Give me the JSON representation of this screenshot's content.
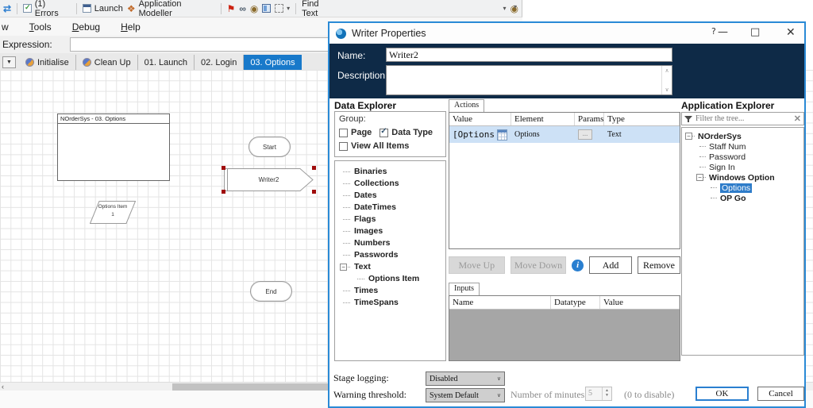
{
  "toolbar": {
    "errors_label": "(1) Errors",
    "launch_label": "Launch",
    "app_modeller_label": "Application Modeller",
    "find_text_label": "Find Text"
  },
  "menubar": {
    "items": [
      "w",
      "Tools",
      "Debug",
      "Help"
    ]
  },
  "expression": {
    "label": "Expression:",
    "value": ""
  },
  "tabs": {
    "initialise": "Initialise",
    "cleanup": "Clean Up",
    "launch": "01. Launch",
    "login": "02. Login",
    "options": "03. Options"
  },
  "diagram": {
    "page_box_title": "NOrderSys - 03. Options",
    "start_label": "Start",
    "writer_label": "Writer2",
    "data_item_label": "Options Item",
    "data_item_value": "1",
    "end_label": "End"
  },
  "dialog": {
    "title": "Writer Properties",
    "window_buttons": {
      "help": "?",
      "minimize": "—",
      "maximize": "□",
      "close": "✕"
    },
    "name_label": "Name:",
    "name_value": "Writer2",
    "description_label": "Description:",
    "description_value": "",
    "data_explorer": {
      "heading": "Data Explorer",
      "group_label": "Group:",
      "checkboxes": [
        {
          "label": "Page",
          "checked": false
        },
        {
          "label": "Data Type",
          "checked": true
        },
        {
          "label": "View All Items",
          "checked": false
        }
      ],
      "tree": [
        "Binaries",
        "Collections",
        "Dates",
        "DateTimes",
        "Flags",
        "Images",
        "Numbers",
        "Passwords",
        "Text",
        "Options Item",
        "Times",
        "TimeSpans"
      ]
    },
    "actions": {
      "tab_label": "Actions",
      "columns": [
        "Value",
        "Element",
        "Params",
        "Type"
      ],
      "row": {
        "value": "[Options",
        "element": "Options",
        "params": "...",
        "type": "Text"
      },
      "move_up": "Move Up",
      "move_down": "Move Down",
      "add": "Add",
      "remove": "Remove"
    },
    "inputs": {
      "tab_label": "Inputs",
      "columns": [
        "Name",
        "Datatype",
        "Value"
      ]
    },
    "app_explorer": {
      "heading": "Application Explorer",
      "filter_placeholder": "Filter the tree...",
      "tree": [
        "NOrderSys",
        "Staff Num",
        "Password",
        "Sign In",
        "Windows Option",
        "Options",
        "OP Go"
      ]
    },
    "footer": {
      "stage_logging_label": "Stage logging:",
      "stage_logging_value": "Disabled",
      "warning_threshold_label": "Warning threshold:",
      "warning_threshold_value": "System Default",
      "minutes_label": "Number of minutes",
      "minutes_value": "5",
      "disable_hint": "(0 to disable)",
      "ok": "OK",
      "cancel": "Cancel"
    }
  }
}
